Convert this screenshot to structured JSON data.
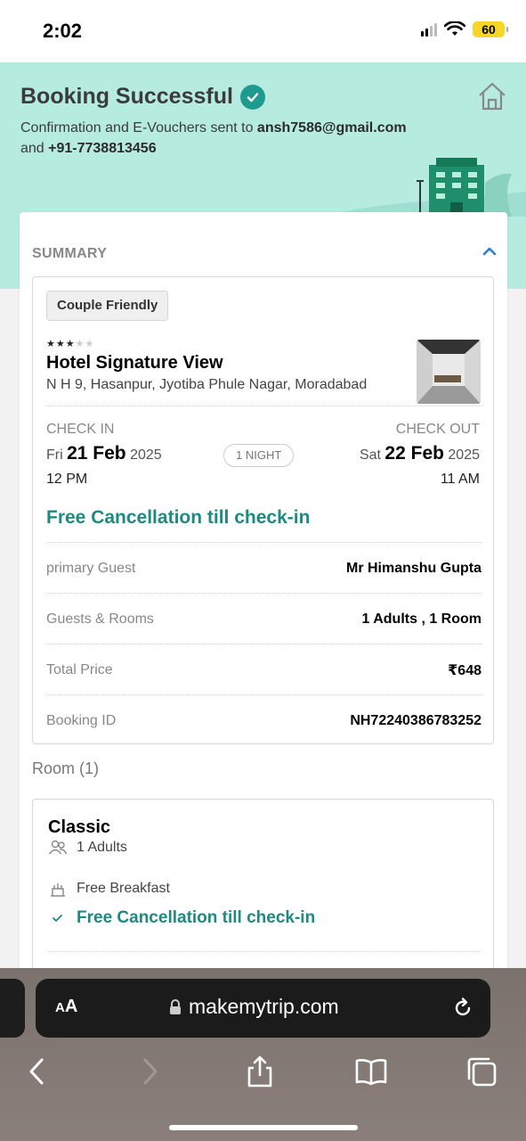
{
  "status_bar": {
    "time": "2:02",
    "battery": "60"
  },
  "header": {
    "title": "Booking Successful",
    "sub_prefix": "Confirmation and E-Vouchers sent to ",
    "email": "ansh7586@gmail.com",
    "sub_mid": "and ",
    "phone": "+91-7738813456"
  },
  "summary": {
    "label": "SUMMARY",
    "tag": "Couple Friendly",
    "hotel_rating": 3,
    "hotel_name": "Hotel Signature View",
    "address": "N H 9, Hasanpur, Jyotiba Phule Nagar, Moradabad",
    "check_in": {
      "label": "CHECK IN",
      "day": "Fri",
      "date": "21 Feb",
      "year": "2025",
      "time": "12 PM"
    },
    "check_out": {
      "label": "CHECK OUT",
      "day": "Sat",
      "date": "22 Feb",
      "year": "2025",
      "time": "11 AM"
    },
    "nights": "1 NIGHT",
    "free_cancellation": "Free Cancellation till check-in",
    "rows": [
      {
        "key": "primary Guest",
        "value": "Mr Himanshu Gupta"
      },
      {
        "key": "Guests & Rooms",
        "value": "1 Adults , 1 Room"
      },
      {
        "key": "Total Price",
        "value": "₹648"
      },
      {
        "key": "Booking ID",
        "value": "NH72240386783252"
      }
    ]
  },
  "room": {
    "heading": "Room (1)",
    "name": "Classic",
    "guests": "1 Adults",
    "meal": "Free Breakfast",
    "cancellation": "Free Cancellation till check-in"
  },
  "browser": {
    "aa_big": "A",
    "aa_small": "A",
    "url": "makemytrip.com"
  },
  "colors": {
    "accent": "#1d8a82",
    "header_bg": "#b6ebe0",
    "link": "#2a7fd4"
  }
}
